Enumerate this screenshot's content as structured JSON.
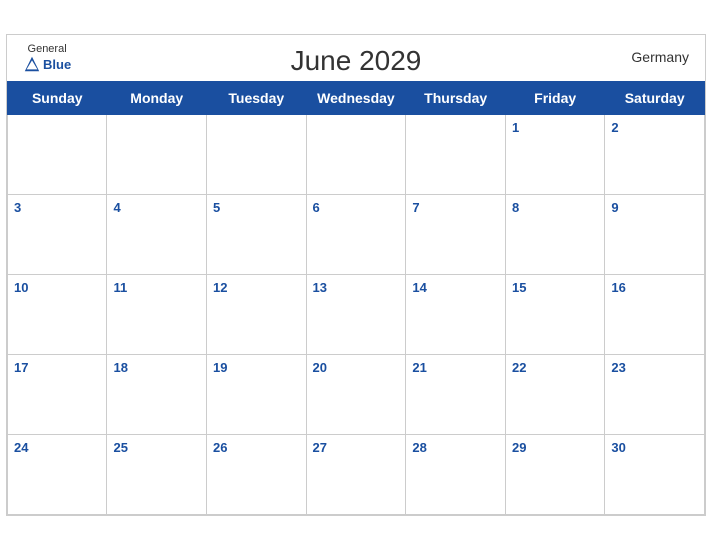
{
  "header": {
    "title": "June 2029",
    "country": "Germany",
    "logo": {
      "general": "General",
      "blue": "Blue"
    }
  },
  "weekdays": [
    "Sunday",
    "Monday",
    "Tuesday",
    "Wednesday",
    "Thursday",
    "Friday",
    "Saturday"
  ],
  "weeks": [
    [
      null,
      null,
      null,
      null,
      null,
      1,
      2
    ],
    [
      3,
      4,
      5,
      6,
      7,
      8,
      9
    ],
    [
      10,
      11,
      12,
      13,
      14,
      15,
      16
    ],
    [
      17,
      18,
      19,
      20,
      21,
      22,
      23
    ],
    [
      24,
      25,
      26,
      27,
      28,
      29,
      30
    ]
  ]
}
